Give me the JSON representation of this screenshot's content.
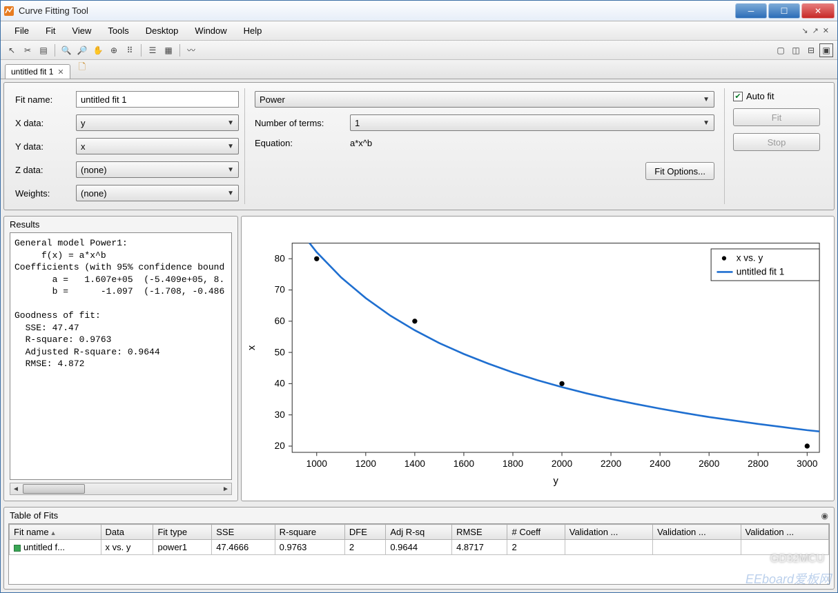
{
  "window": {
    "title": "Curve Fitting Tool"
  },
  "menu": {
    "items": [
      "File",
      "Fit",
      "View",
      "Tools",
      "Desktop",
      "Window",
      "Help"
    ]
  },
  "tab": {
    "name": "untitled fit 1"
  },
  "form": {
    "fit_name_label": "Fit name:",
    "fit_name_value": "untitled fit 1",
    "x_data_label": "X data:",
    "x_data_value": "y",
    "y_data_label": "Y data:",
    "y_data_value": "x",
    "z_data_label": "Z data:",
    "z_data_value": "(none)",
    "weights_label": "Weights:",
    "weights_value": "(none)"
  },
  "model": {
    "type_value": "Power",
    "nterms_label": "Number of terms:",
    "nterms_value": "1",
    "eq_label": "Equation:",
    "eq_value": "a*x^b",
    "fit_options_btn": "Fit Options..."
  },
  "right": {
    "auto_fit_label": "Auto fit",
    "auto_fit_checked": true,
    "fit_btn": "Fit",
    "stop_btn": "Stop"
  },
  "results": {
    "title": "Results",
    "text": "General model Power1:\n     f(x) = a*x^b\nCoefficients (with 95% confidence bound\n       a =   1.607e+05  (-5.409e+05, 8.\n       b =      -1.097  (-1.708, -0.486\n\nGoodness of fit:\n  SSE: 47.47\n  R-square: 0.9763\n  Adjusted R-square: 0.9644\n  RMSE: 4.872"
  },
  "table_of_fits": {
    "title": "Table of Fits",
    "columns": [
      "Fit name",
      "Data",
      "Fit type",
      "SSE",
      "R-square",
      "DFE",
      "Adj R-sq",
      "RMSE",
      "# Coeff",
      "Validation ...",
      "Validation ...",
      "Validation ..."
    ],
    "row": {
      "fit_name": "untitled f...",
      "data": "x vs. y",
      "fit_type": "power1",
      "sse": "47.4666",
      "rsq": "0.9763",
      "dfe": "2",
      "adjrsq": "0.9644",
      "rmse": "4.8717",
      "ncoeff": "2",
      "v1": "",
      "v2": "",
      "v3": ""
    }
  },
  "chart_data": {
    "type": "line",
    "title": "",
    "xlabel": "y",
    "ylabel": "x",
    "xlim": [
      900,
      3050
    ],
    "ylim": [
      18,
      85
    ],
    "xticks": [
      1000,
      1200,
      1400,
      1600,
      1800,
      2000,
      2200,
      2400,
      2600,
      2800,
      3000
    ],
    "yticks": [
      20,
      30,
      40,
      50,
      60,
      70,
      80
    ],
    "legend": {
      "position": "top-right",
      "items": [
        {
          "name": "x vs. y",
          "type": "scatter"
        },
        {
          "name": "untitled fit 1",
          "type": "line",
          "color": "#1f6fd0"
        }
      ]
    },
    "series": [
      {
        "name": "x vs. y",
        "type": "scatter",
        "color": "#000000",
        "x": [
          1000,
          1400,
          2000,
          3000
        ],
        "y": [
          80,
          60,
          40,
          20
        ]
      },
      {
        "name": "untitled fit 1",
        "type": "line",
        "color": "#1f6fd0",
        "x": [
          900,
          1000,
          1100,
          1200,
          1300,
          1400,
          1500,
          1600,
          1700,
          1800,
          1900,
          2000,
          2100,
          2200,
          2300,
          2400,
          2500,
          2600,
          2700,
          2800,
          2900,
          3000,
          3050
        ],
        "y": [
          92.1,
          82.1,
          74.0,
          67.4,
          61.8,
          57.1,
          53.0,
          49.5,
          46.4,
          43.6,
          41.1,
          38.9,
          36.9,
          35.1,
          33.5,
          32.0,
          30.6,
          29.3,
          28.2,
          27.1,
          26.1,
          25.1,
          24.7
        ]
      }
    ]
  },
  "watermarks": {
    "w1": "GD32MCU",
    "w2": "EEboard爱板网"
  }
}
